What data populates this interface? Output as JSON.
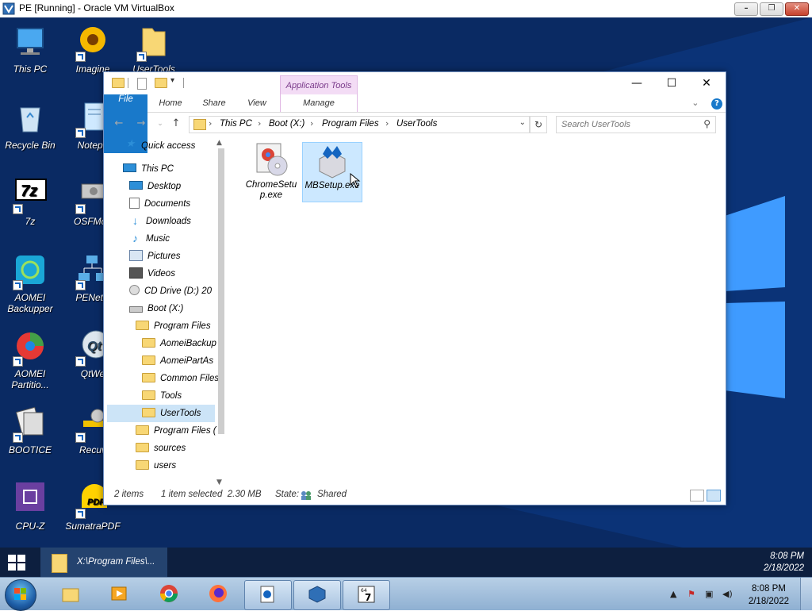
{
  "host": {
    "title": "PE [Running] - Oracle VM VirtualBox",
    "controls": {
      "minimize": "–",
      "restore": "❐",
      "close": "✕"
    },
    "clock": {
      "time": "8:08 PM",
      "date": "2/18/2022"
    }
  },
  "desktop_icons": [
    {
      "label": "This PC"
    },
    {
      "label": "Imagine"
    },
    {
      "label": "UserTools"
    },
    {
      "label": "Recycle Bin"
    },
    {
      "label": "Notepa"
    },
    {
      "label": "7z"
    },
    {
      "label": "OSFMou"
    },
    {
      "label": "AOMEI Backupper"
    },
    {
      "label": "PENetw"
    },
    {
      "label": "AOMEI Partitio..."
    },
    {
      "label": "QtWe"
    },
    {
      "label": "BOOTICE"
    },
    {
      "label": "Recuv"
    },
    {
      "label": "CPU-Z"
    },
    {
      "label": "SumatraPDF"
    }
  ],
  "explorer": {
    "context_tab": "Application Tools",
    "tabs": {
      "file": "File",
      "home": "Home",
      "share": "Share",
      "view": "View",
      "manage": "Manage"
    },
    "window_controls": {
      "minimize": "—",
      "maximize": "☐",
      "close": "✕"
    },
    "breadcrumb": [
      "This PC",
      "Boot (X:)",
      "Program Files",
      "UserTools"
    ],
    "search_placeholder": "Search UserTools",
    "nav": [
      {
        "label": "Quick access"
      },
      {
        "label": "This PC"
      },
      {
        "label": "Desktop"
      },
      {
        "label": "Documents"
      },
      {
        "label": "Downloads"
      },
      {
        "label": "Music"
      },
      {
        "label": "Pictures"
      },
      {
        "label": "Videos"
      },
      {
        "label": "CD Drive (D:) 20"
      },
      {
        "label": "Boot (X:)"
      },
      {
        "label": "Program Files"
      },
      {
        "label": "AomeiBackup"
      },
      {
        "label": "AomeiPartAs"
      },
      {
        "label": "Common Files"
      },
      {
        "label": "Tools"
      },
      {
        "label": "UserTools"
      },
      {
        "label": "Program Files ("
      },
      {
        "label": "sources"
      },
      {
        "label": "users"
      }
    ],
    "files": [
      {
        "name": "ChromeSetup.exe",
        "selected": false
      },
      {
        "name": "MBSetup.exe",
        "selected": true
      }
    ],
    "status": {
      "items": "2 items",
      "selected": "1 item selected  2.30 MB",
      "state_label": "State:",
      "state_value": "Shared"
    }
  },
  "guest_taskbar": {
    "active_item": "X:\\Program Files\\...",
    "time": "8:08 PM",
    "date": "2/18/2022"
  },
  "colors": {
    "explorer_file_tab": "#1979ca",
    "selection": "#cce8ff",
    "context_tab": "#f3dcf5",
    "desktop_bg": "#0a2a63"
  }
}
